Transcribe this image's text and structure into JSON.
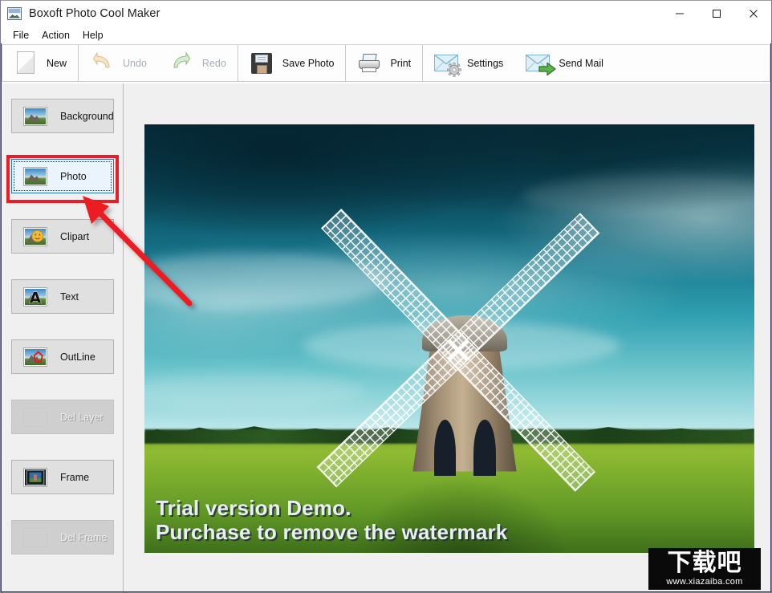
{
  "window": {
    "title": "Boxoft Photo Cool Maker",
    "icon": "app-photo-icon",
    "controls": {
      "minimize": "minimize",
      "maximize": "maximize",
      "close": "close"
    }
  },
  "menubar": {
    "items": [
      {
        "label": "File"
      },
      {
        "label": "Action"
      },
      {
        "label": "Help"
      }
    ]
  },
  "toolbar": {
    "groups": [
      {
        "buttons": [
          {
            "label": "New",
            "icon": "new-page-icon",
            "enabled": true
          }
        ]
      },
      {
        "buttons": [
          {
            "label": "Undo",
            "icon": "undo-arrow-icon",
            "enabled": false
          },
          {
            "label": "Redo",
            "icon": "redo-arrow-icon",
            "enabled": false
          }
        ]
      },
      {
        "buttons": [
          {
            "label": "Save Photo",
            "icon": "floppy-disk-icon",
            "enabled": true
          }
        ]
      },
      {
        "buttons": [
          {
            "label": "Print",
            "icon": "printer-icon",
            "enabled": true
          }
        ]
      },
      {
        "buttons": [
          {
            "label": "Settings",
            "icon": "envelope-gear-icon",
            "enabled": true
          },
          {
            "label": "Send Mail",
            "icon": "envelope-arrow-icon",
            "enabled": true
          }
        ]
      }
    ]
  },
  "sidebar": {
    "items": [
      {
        "label": "Background",
        "icon": "landscape-thumb-icon",
        "state": "normal"
      },
      {
        "label": "Photo",
        "icon": "landscape-thumb-icon",
        "state": "selected"
      },
      {
        "label": "Clipart",
        "icon": "smiley-clipart-icon",
        "state": "normal"
      },
      {
        "label": "Text",
        "icon": "text-letter-a-icon",
        "state": "normal"
      },
      {
        "label": "OutLine",
        "icon": "outline-shape-icon",
        "state": "normal"
      },
      {
        "label": "Del Layer",
        "icon": "delete-layer-icon",
        "state": "disabled"
      },
      {
        "label": "Frame",
        "icon": "picture-frame-icon",
        "state": "normal"
      },
      {
        "label": "Del Frame",
        "icon": "delete-frame-icon",
        "state": "disabled"
      }
    ]
  },
  "canvas": {
    "photo_name": "windmill-field-photo",
    "watermark_text": "Trial version Demo.\nPurchase to remove the watermark"
  },
  "annotation": {
    "highlight_target": "Photo",
    "arrow_color": "#ed1c24",
    "rect_color": "#ed1c24"
  },
  "site_watermark": {
    "logo_text": "下载吧",
    "url": "www.xiazaiba.com"
  }
}
